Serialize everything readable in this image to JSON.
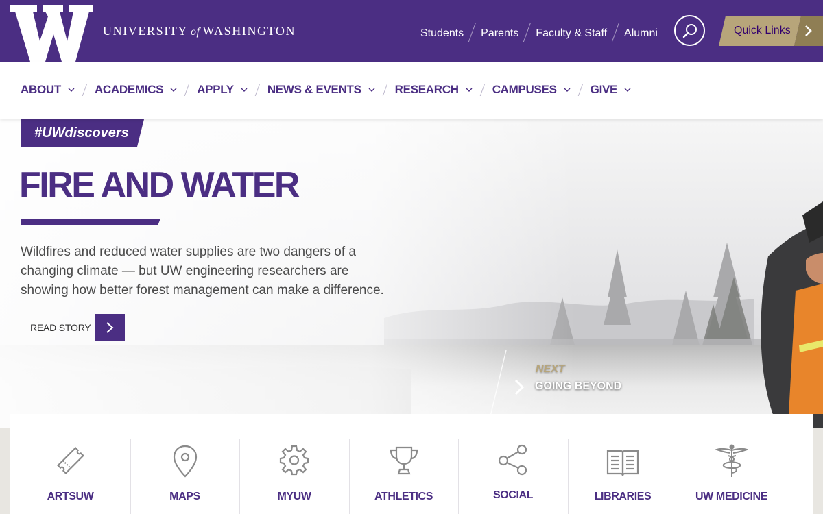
{
  "header": {
    "wordmark_left": "UNIVERSITY",
    "wordmark_of": "of",
    "wordmark_right": "WASHINGTON",
    "audience_links": [
      "Students",
      "Parents",
      "Faculty & Staff",
      "Alumni"
    ],
    "search_icon": "search-icon",
    "quick_links_label": "Quick Links",
    "colors": {
      "purple": "#4b2e83",
      "gold": "#b7a57a"
    }
  },
  "nav": {
    "items": [
      "ABOUT",
      "ACADEMICS",
      "APPLY",
      "NEWS & EVENTS",
      "RESEARCH",
      "CAMPUSES",
      "GIVE"
    ]
  },
  "hero": {
    "hashtag": "#UWdiscovers",
    "headline": "FIRE AND WATER",
    "summary": "Wildfires and reduced water supplies are two dangers of a changing climate — but UW engineering researchers are showing how better forest management can make a difference.",
    "read_story": "READ STORY",
    "next_label": "NEXT",
    "next_title": "GOING BEYOND"
  },
  "tiles": [
    {
      "label": "ARTSUW",
      "icon": "ticket-icon"
    },
    {
      "label": "MAPS",
      "icon": "map-pin-icon"
    },
    {
      "label": "MYUW",
      "icon": "gear-icon"
    },
    {
      "label": "ATHLETICS",
      "icon": "trophy-icon"
    },
    {
      "label": "SOCIAL",
      "icon": "share-icon"
    },
    {
      "label": "LIBRARIES",
      "icon": "book-icon"
    },
    {
      "label": "UW MEDICINE",
      "icon": "caduceus-icon"
    }
  ]
}
